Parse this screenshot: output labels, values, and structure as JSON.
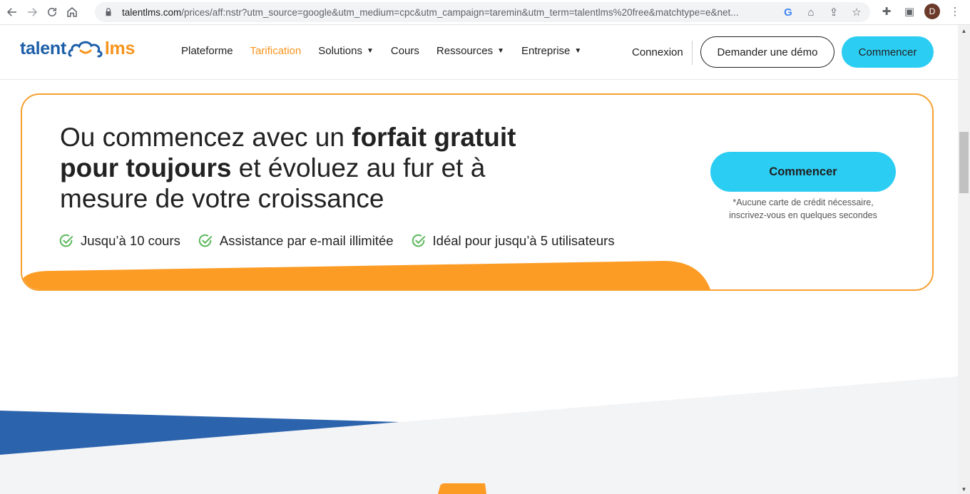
{
  "browser": {
    "url_host": "talentlms.com",
    "url_rest": "/prices/aff:nstr?utm_source=google&utm_medium=cpc&utm_campaign=taremin&utm_term=talentlms%20free&matchtype=e&net...",
    "profile_initial": "D"
  },
  "header": {
    "logo_left": "talent",
    "logo_right": "lms",
    "menu": [
      {
        "label": "Plateforme",
        "dropdown": false,
        "active": false
      },
      {
        "label": "Tarification",
        "dropdown": false,
        "active": true
      },
      {
        "label": "Solutions",
        "dropdown": true,
        "active": false
      },
      {
        "label": "Cours",
        "dropdown": false,
        "active": false
      },
      {
        "label": "Ressources",
        "dropdown": true,
        "active": false
      },
      {
        "label": "Entreprise",
        "dropdown": true,
        "active": false
      }
    ],
    "login_label": "Connexion",
    "demo_label": "Demander une démo",
    "start_label": "Commencer"
  },
  "promo": {
    "headline_part1": "Ou commencez avec un ",
    "headline_bold1": "forfait gratuit",
    "headline_bold2": "pour toujours",
    "headline_part2": " et évoluez au fur et à",
    "headline_part3": "mesure de votre croissance",
    "features": [
      "Jusqu’à 10 cours",
      "Assistance par e-mail illimitée",
      "Idéal pour jusqu’à 5 utilisateurs"
    ],
    "cta_label": "Commencer",
    "note_line1": "*Aucune carte de crédit nécessaire,",
    "note_line2": "inscrivez-vous en quelques secondes"
  },
  "colors": {
    "brand_blue": "#1d5fa8",
    "brand_orange": "#f7941d",
    "cta_cyan": "#2ccdf3",
    "check_green": "#5cb85c"
  }
}
